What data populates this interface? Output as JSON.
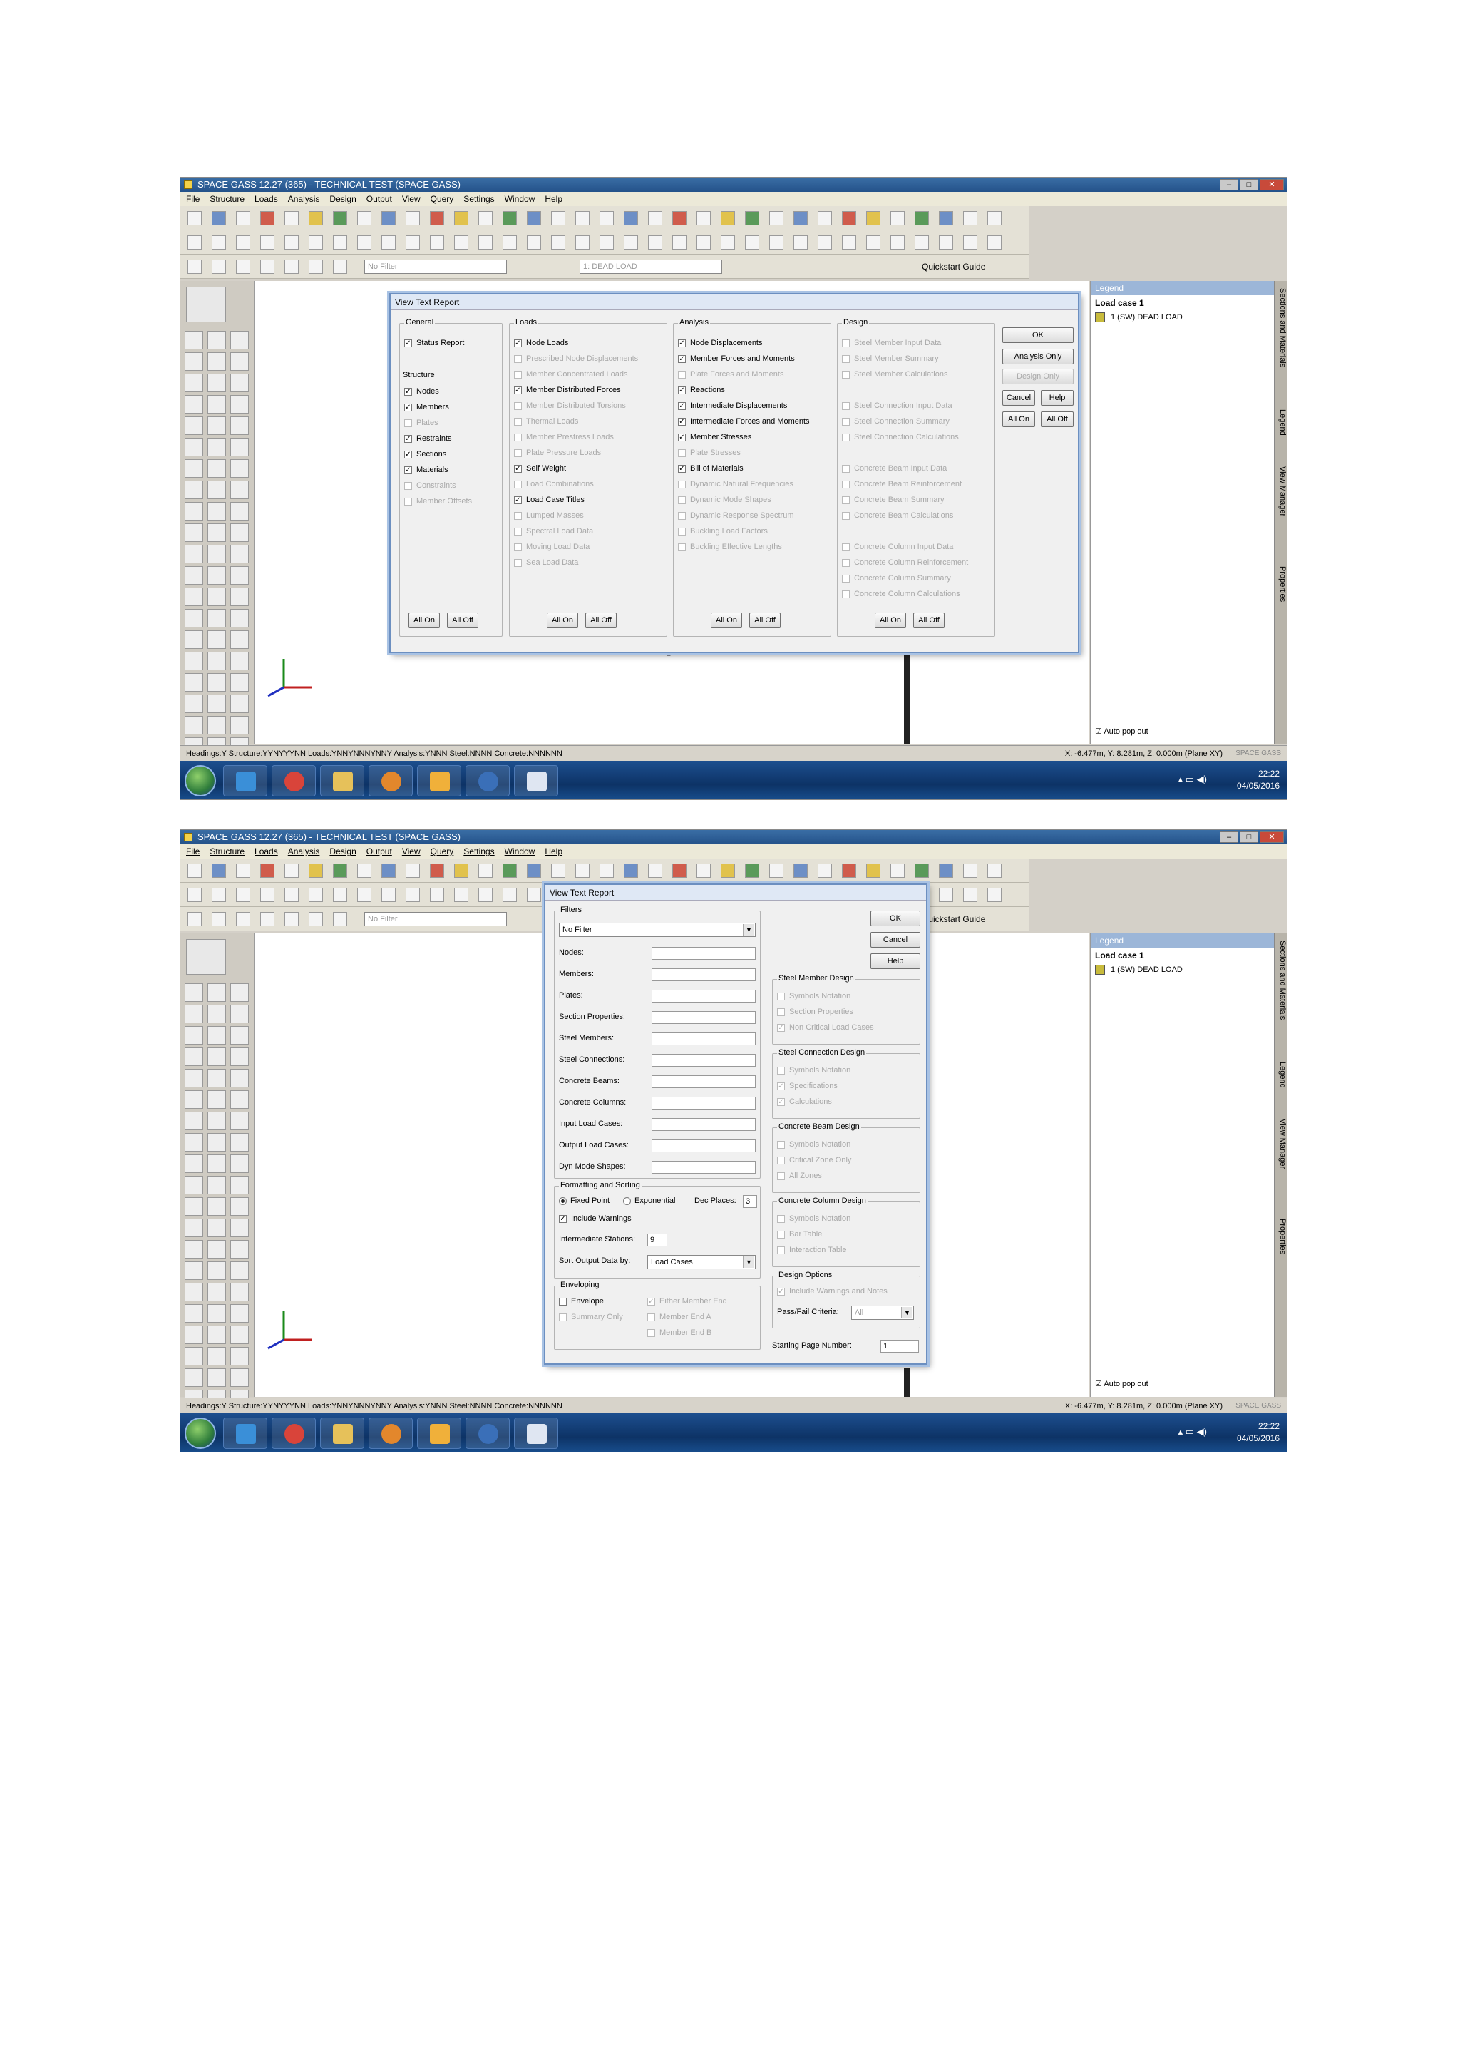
{
  "app": {
    "title": "SPACE GASS 12.27 (365) - TECHNICAL TEST (SPACE GASS)",
    "menus": [
      "File",
      "Structure",
      "Loads",
      "Analysis",
      "Design",
      "Output",
      "View",
      "Query",
      "Settings",
      "Window",
      "Help"
    ],
    "filter_placeholder": "No Filter",
    "loadcase_select": "1: DEAD LOAD",
    "quickstart": "Quickstart Guide"
  },
  "legend": {
    "title": "Legend",
    "case": "Load case 1",
    "row": "1 (SW)   DEAD LOAD",
    "autopop": "Auto pop out",
    "swatch": "#c8bb3c"
  },
  "side_tabs": [
    "Sections and Materials",
    "Legend",
    "View Manager",
    "Properties"
  ],
  "status": {
    "left": "Headings:Y Structure:YYNYYYNN Loads:YNNYNNNYNNY Analysis:YNNN Steel:NNNN Concrete:NNNNNN",
    "right": "X: -6.477m, Y: 8.281m, Z: 0.000m (Plane XY)",
    "brand": "SPACE GASS"
  },
  "clock": {
    "time": "22:22",
    "date": "04/05/2016"
  },
  "dialog1": {
    "title": "View Text Report",
    "groups": {
      "general": "General",
      "structure": "Structure",
      "loads": "Loads",
      "analysis": "Analysis",
      "design": "Design"
    },
    "general": [
      {
        "label": "Status Report",
        "checked": true,
        "enabled": true
      }
    ],
    "structure": [
      {
        "label": "Nodes",
        "checked": true,
        "enabled": true
      },
      {
        "label": "Members",
        "checked": true,
        "enabled": true
      },
      {
        "label": "Plates",
        "checked": false,
        "enabled": false
      },
      {
        "label": "Restraints",
        "checked": true,
        "enabled": true
      },
      {
        "label": "Sections",
        "checked": true,
        "enabled": true
      },
      {
        "label": "Materials",
        "checked": true,
        "enabled": true
      },
      {
        "label": "Constraints",
        "checked": false,
        "enabled": false
      },
      {
        "label": "Member Offsets",
        "checked": false,
        "enabled": false
      }
    ],
    "loads": [
      {
        "label": "Node Loads",
        "checked": true,
        "enabled": true
      },
      {
        "label": "Prescribed Node Displacements",
        "checked": false,
        "enabled": false
      },
      {
        "label": "Member Concentrated Loads",
        "checked": false,
        "enabled": false
      },
      {
        "label": "Member Distributed Forces",
        "checked": true,
        "enabled": true
      },
      {
        "label": "Member Distributed Torsions",
        "checked": false,
        "enabled": false
      },
      {
        "label": "Thermal Loads",
        "checked": false,
        "enabled": false
      },
      {
        "label": "Member Prestress Loads",
        "checked": false,
        "enabled": false
      },
      {
        "label": "Plate Pressure Loads",
        "checked": false,
        "enabled": false
      },
      {
        "label": "Self Weight",
        "checked": true,
        "enabled": true
      },
      {
        "label": "Load Combinations",
        "checked": false,
        "enabled": false
      },
      {
        "label": "Load Case Titles",
        "checked": true,
        "enabled": true
      },
      {
        "label": "Lumped Masses",
        "checked": false,
        "enabled": false
      },
      {
        "label": "Spectral Load Data",
        "checked": false,
        "enabled": false
      },
      {
        "label": "Moving Load Data",
        "checked": false,
        "enabled": false
      },
      {
        "label": "Sea Load Data",
        "checked": false,
        "enabled": false
      }
    ],
    "analysis": [
      {
        "label": "Node Displacements",
        "checked": true,
        "enabled": true
      },
      {
        "label": "Member Forces and Moments",
        "checked": true,
        "enabled": true
      },
      {
        "label": "Plate Forces and Moments",
        "checked": false,
        "enabled": false
      },
      {
        "label": "Reactions",
        "checked": true,
        "enabled": true
      },
      {
        "label": "Intermediate Displacements",
        "checked": true,
        "enabled": true
      },
      {
        "label": "Intermediate Forces and Moments",
        "checked": true,
        "enabled": true
      },
      {
        "label": "Member Stresses",
        "checked": true,
        "enabled": true
      },
      {
        "label": "Plate Stresses",
        "checked": false,
        "enabled": false
      },
      {
        "label": "Bill of Materials",
        "checked": true,
        "enabled": true
      },
      {
        "label": "Dynamic Natural Frequencies",
        "checked": false,
        "enabled": false
      },
      {
        "label": "Dynamic Mode Shapes",
        "checked": false,
        "enabled": false
      },
      {
        "label": "Dynamic Response Spectrum",
        "checked": false,
        "enabled": false
      },
      {
        "label": "Buckling Load Factors",
        "checked": false,
        "enabled": false
      },
      {
        "label": "Buckling Effective Lengths",
        "checked": false,
        "enabled": false
      }
    ],
    "design": [
      {
        "label": "Steel Member Input Data",
        "row": 0
      },
      {
        "label": "Steel Member Summary",
        "row": 1
      },
      {
        "label": "Steel Member Calculations",
        "row": 2
      },
      {
        "label": "Steel Connection Input Data",
        "row": 4
      },
      {
        "label": "Steel Connection Summary",
        "row": 5
      },
      {
        "label": "Steel Connection Calculations",
        "row": 6
      },
      {
        "label": "Concrete Beam Input Data",
        "row": 8
      },
      {
        "label": "Concrete Beam Reinforcement",
        "row": 9
      },
      {
        "label": "Concrete Beam Summary",
        "row": 10
      },
      {
        "label": "Concrete Beam Calculations",
        "row": 11
      },
      {
        "label": "Concrete Column Input Data",
        "row": 13
      },
      {
        "label": "Concrete Column Reinforcement",
        "row": 14
      },
      {
        "label": "Concrete Column Summary",
        "row": 15
      },
      {
        "label": "Concrete Column Calculations",
        "row": 16
      }
    ],
    "buttons": {
      "ok": "OK",
      "analysis_only": "Analysis Only",
      "design_only": "Design Only",
      "cancel": "Cancel",
      "help": "Help",
      "all_on": "All On",
      "all_off": "All Off"
    }
  },
  "dialog2": {
    "title": "View Text Report",
    "filters_group": "Filters",
    "filter_select": "No Filter",
    "filter_fields": [
      "Nodes:",
      "Members:",
      "Plates:",
      "Section Properties:",
      "Steel Members:",
      "Steel Connections:",
      "Concrete Beams:",
      "Concrete Columns:",
      "Input Load Cases:",
      "Output Load Cases:",
      "Dyn Mode Shapes:"
    ],
    "formatting": {
      "group": "Formatting and Sorting",
      "fixed_point": "Fixed Point",
      "exponential": "Exponential",
      "dec_places_label": "Dec Places:",
      "dec_places": "3",
      "include_warnings": "Include Warnings",
      "stations_label": "Intermediate Stations:",
      "stations": "9",
      "sort_label": "Sort Output Data by:",
      "sort_value": "Load Cases"
    },
    "enveloping": {
      "group": "Enveloping",
      "envelope": "Envelope",
      "summary_only": "Summary Only",
      "either_end": "Either Member End",
      "end_a": "Member End A",
      "end_b": "Member End B"
    },
    "buttons": {
      "ok": "OK",
      "cancel": "Cancel",
      "help": "Help"
    },
    "smd": {
      "group": "Steel Member Design",
      "items": [
        {
          "label": "Symbols Notation",
          "checked": false
        },
        {
          "label": "Section Properties",
          "checked": false
        },
        {
          "label": "Non Critical Load Cases",
          "checked": true
        }
      ]
    },
    "scd": {
      "group": "Steel Connection Design",
      "items": [
        {
          "label": "Symbols Notation",
          "checked": false
        },
        {
          "label": "Specifications",
          "checked": true
        },
        {
          "label": "Calculations",
          "checked": true
        }
      ]
    },
    "cbd": {
      "group": "Concrete Beam Design",
      "items": [
        {
          "label": "Symbols Notation",
          "checked": false
        },
        {
          "label": "Critical Zone Only",
          "checked": false
        },
        {
          "label": "All Zones",
          "checked": false
        }
      ]
    },
    "ccd": {
      "group": "Concrete Column Design",
      "items": [
        {
          "label": "Symbols Notation",
          "checked": false
        },
        {
          "label": "Bar Table",
          "checked": false
        },
        {
          "label": "Interaction Table",
          "checked": false
        }
      ]
    },
    "dop": {
      "group": "Design Options",
      "include": "Include Warnings and Notes",
      "pf_label": "Pass/Fail Criteria:",
      "pf_value": "All"
    },
    "start_page_label": "Starting Page Number:",
    "start_page": "1"
  }
}
